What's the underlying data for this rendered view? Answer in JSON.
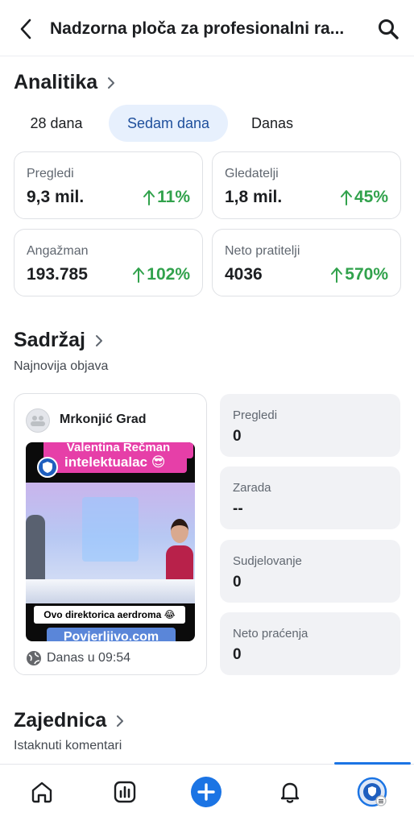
{
  "header": {
    "title": "Nadzorna ploča za profesionalni ra...",
    "back_icon": "chevron-left-icon",
    "search_icon": "search-icon"
  },
  "analytics": {
    "title": "Analitika",
    "tabs": [
      {
        "label": "28 dana",
        "active": false
      },
      {
        "label": "Sedam dana",
        "active": true
      },
      {
        "label": "Danas",
        "active": false
      }
    ],
    "cards": [
      {
        "label": "Pregledi",
        "value": "9,3 mil.",
        "change": "11%"
      },
      {
        "label": "Gledatelji",
        "value": "1,8 mil.",
        "change": "45%"
      },
      {
        "label": "Angažman",
        "value": "193.785",
        "change": "102%"
      },
      {
        "label": "Neto pratitelji",
        "value": "4036",
        "change": "570%"
      }
    ],
    "positive_color": "#31a24c"
  },
  "content": {
    "title": "Sadržaj",
    "subtitle": "Najnovija objava",
    "post": {
      "page_name": "Mrkonjić Grad",
      "caption_top_1": "Valentina Rečman",
      "caption_top_2": "intelektualac 😎",
      "caption_middle": "Ovo direktorica aerdroma 😂",
      "caption_bottom": "Povjerljivo.com",
      "time": "Danas u 09:54"
    },
    "metrics": [
      {
        "label": "Pregledi",
        "value": "0"
      },
      {
        "label": "Zarada",
        "value": "--"
      },
      {
        "label": "Sudjelovanje",
        "value": "0"
      },
      {
        "label": "Neto praćenja",
        "value": "0"
      }
    ]
  },
  "community": {
    "title": "Zajednica",
    "subtitle": "Istaknuti komentari"
  },
  "nav": {
    "items": [
      "home-icon",
      "insights-icon",
      "create-icon",
      "notifications-icon",
      "profile-icon"
    ],
    "active_index": 4,
    "accent": "#1b74e4"
  }
}
